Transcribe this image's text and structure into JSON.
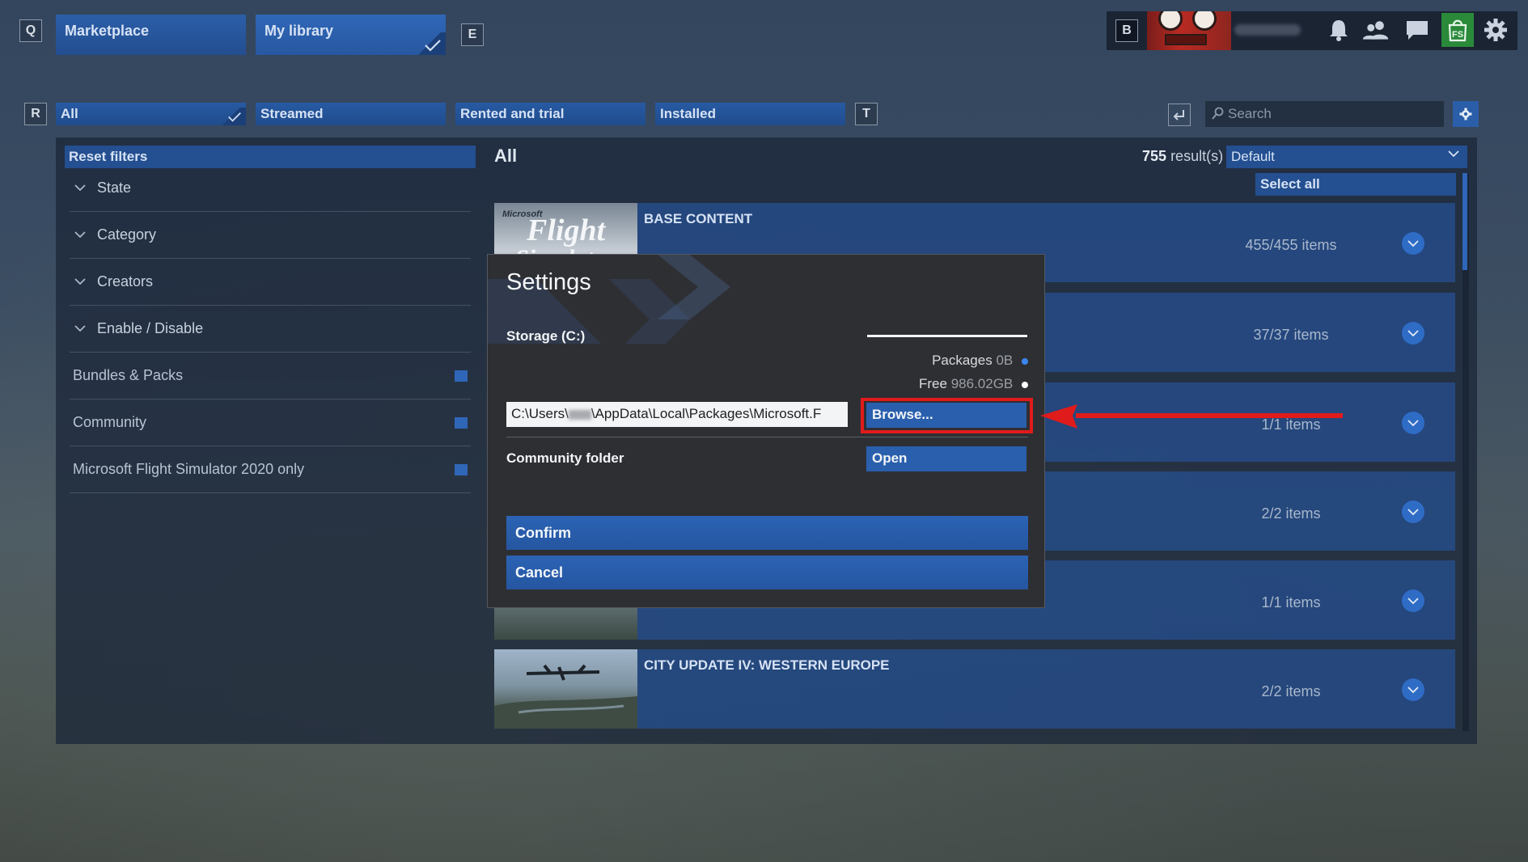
{
  "keys": {
    "q": "Q",
    "e": "E",
    "r": "R",
    "t": "T",
    "b": "B"
  },
  "top_tabs": [
    {
      "label": "Marketplace",
      "active": false
    },
    {
      "label": "My library",
      "active": true
    }
  ],
  "filter_tabs": [
    {
      "label": "All",
      "active": true
    },
    {
      "label": "Streamed",
      "active": false
    },
    {
      "label": "Rented and trial",
      "active": false
    },
    {
      "label": "Installed",
      "active": false
    }
  ],
  "search": {
    "placeholder": "Search"
  },
  "sidebar": {
    "reset_label": "Reset filters",
    "groups": [
      "State",
      "Category",
      "Creators",
      "Enable / Disable"
    ],
    "toggles": [
      "Bundles & Packs",
      "Community",
      "Microsoft Flight Simulator 2020 only"
    ]
  },
  "content": {
    "title": "All",
    "results_count": "755",
    "results_suffix": "result(s)",
    "sort_value": "Default",
    "select_all": "Select all",
    "rows": [
      {
        "title": "BASE CONTENT",
        "count": "455/455 items",
        "thumb_text_1": "Microsoft",
        "thumb_text_2": "Flight",
        "thumb_text_3": "Simulator"
      },
      {
        "title": "",
        "count": "37/37 items"
      },
      {
        "title": "",
        "count": "1/1 items"
      },
      {
        "title": "",
        "count": "2/2 items"
      },
      {
        "title": "",
        "count": "1/1 items"
      },
      {
        "title": "CITY UPDATE IV: WESTERN EUROPE",
        "count": "2/2 items"
      }
    ]
  },
  "modal": {
    "title": "Settings",
    "storage_label": "Storage (C:)",
    "packages_label": "Packages",
    "packages_value": "0B",
    "free_label": "Free",
    "free_value": "986.02GB",
    "path_start": "C:\\Users\\",
    "path_end": "\\AppData\\Local\\Packages\\Microsoft.F",
    "browse_label": "Browse...",
    "community_label": "Community folder",
    "open_label": "Open",
    "confirm_label": "Confirm",
    "cancel_label": "Cancel"
  },
  "colors": {
    "accent": "#2a5fad",
    "highlight": "#e01b1b",
    "packages_dot": "#3c86f0",
    "free_dot": "#ffffff"
  },
  "icons": [
    "bell-icon",
    "friends-icon",
    "chat-icon",
    "store-icon",
    "gear-icon",
    "search-icon",
    "enter-icon",
    "settings-small-icon",
    "chevron-down-icon",
    "checkmark-icon"
  ]
}
